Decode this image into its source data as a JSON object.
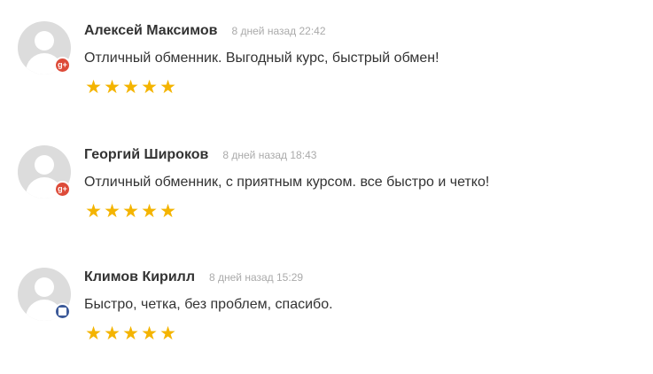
{
  "reviews": [
    {
      "author": "Алексей Максимов",
      "date": "8 дней назад 22:42",
      "text": "Отличный обменник. Выгодный курс, быстрый обмен!",
      "rating": 5,
      "source_icon": "google-plus-icon",
      "badge_text": "g+"
    },
    {
      "author": "Георгий Широков",
      "date": "8 дней назад 18:43",
      "text": "Отличный обменник, с приятным курсом. все быстро и четко!",
      "rating": 5,
      "source_icon": "google-plus-icon",
      "badge_text": "g+"
    },
    {
      "author": "Климов Кирилл",
      "date": "8 дней назад 15:29",
      "text": "Быстро, четка, без проблем, спасибо.",
      "rating": 5,
      "source_icon": "square-icon"
    }
  ],
  "colors": {
    "star": "#f4b400",
    "google_plus": "#dd4b39",
    "square_badge": "#3b5998"
  }
}
